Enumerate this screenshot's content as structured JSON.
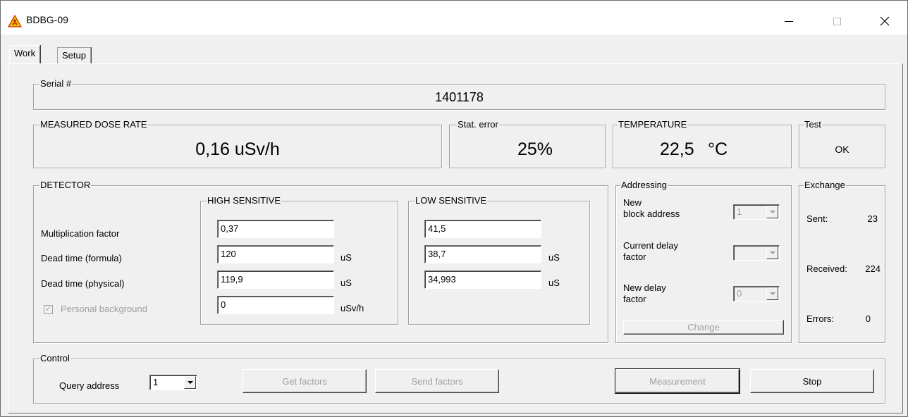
{
  "window": {
    "title": "BDBG-09",
    "icon": "radiation-warning-icon"
  },
  "tabs": [
    {
      "label": "Work",
      "active": true
    },
    {
      "label": "Setup",
      "active": false
    }
  ],
  "serial": {
    "label": "Serial #",
    "value": "1401178"
  },
  "dose_rate": {
    "label": "MEASURED DOSE RATE",
    "value": "0,16 uSv/h"
  },
  "stat_error": {
    "label": "Stat. error",
    "value": "25%"
  },
  "temperature": {
    "label": "TEMPERATURE",
    "value": "22,5",
    "unit": "°C"
  },
  "test": {
    "label": "Test",
    "value": "OK"
  },
  "detector": {
    "label": "DETECTOR",
    "rows": {
      "multiplication": "Multiplication factor",
      "dead_formula": "Dead time (formula)",
      "dead_physical": "Dead time (physical)",
      "personal_bg": "Personal background"
    },
    "personal_bg_checked": true,
    "high": {
      "label": "HIGH SENSITIVE",
      "multiplication": "0,37",
      "dead_formula": "120",
      "dead_physical": "119,9",
      "personal_bg": "0",
      "unit_formula": "uS",
      "unit_physical": "uS",
      "unit_bg": "uSv/h"
    },
    "low": {
      "label": "LOW SENSITIVE",
      "multiplication": "41,5",
      "dead_formula": "38,7",
      "dead_physical": "34,993",
      "unit_formula": "uS",
      "unit_physical": "uS"
    }
  },
  "addressing": {
    "label": "Addressing",
    "new_block_address_label_1": "New",
    "new_block_address_label_2": "block address",
    "new_block_address_value": "1",
    "current_delay_label_1": "Current delay",
    "current_delay_label_2": "factor",
    "current_delay_value": "",
    "new_delay_label_1": "New delay",
    "new_delay_label_2": "factor",
    "new_delay_value": "0",
    "change_button": "Change"
  },
  "exchange": {
    "label": "Exchange",
    "sent_label": "Sent:",
    "sent_value": "23",
    "received_label": "Received:",
    "received_value": "224",
    "errors_label": "Errors:",
    "errors_value": "0"
  },
  "control": {
    "label": "Control",
    "query_address_label": "Query address",
    "query_address_value": "1",
    "get_factors": "Get factors",
    "send_factors": "Send factors",
    "measurement": "Measurement",
    "stop": "Stop"
  }
}
